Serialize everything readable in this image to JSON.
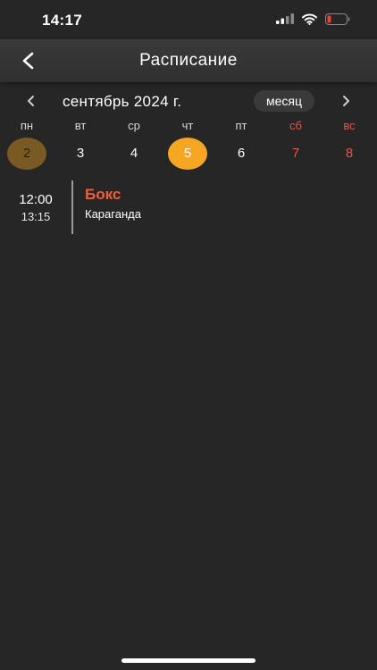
{
  "status_bar": {
    "time": "14:17",
    "icons": [
      "signal-icon",
      "wifi-icon",
      "battery-icon"
    ]
  },
  "header": {
    "title": "Расписание",
    "back_icon": "chevron-left-icon"
  },
  "calendar": {
    "month_label": "сентябрь 2024 г.",
    "view_toggle_label": "месяц",
    "prev_icon": "chevron-left-icon",
    "next_icon": "chevron-right-icon",
    "weekdays": [
      {
        "label": "пн",
        "weekend": false
      },
      {
        "label": "вт",
        "weekend": false
      },
      {
        "label": "ср",
        "weekend": false
      },
      {
        "label": "чт",
        "weekend": false
      },
      {
        "label": "пт",
        "weekend": false
      },
      {
        "label": "сб",
        "weekend": true
      },
      {
        "label": "вс",
        "weekend": true
      }
    ],
    "days": [
      {
        "label": "2",
        "state": "current"
      },
      {
        "label": "3",
        "state": "normal"
      },
      {
        "label": "4",
        "state": "normal"
      },
      {
        "label": "5",
        "state": "selected"
      },
      {
        "label": "6",
        "state": "normal"
      },
      {
        "label": "7",
        "state": "weekend"
      },
      {
        "label": "8",
        "state": "weekend"
      }
    ]
  },
  "events": [
    {
      "start": "12:00",
      "end": "13:15",
      "title": "Бокс",
      "location": "Караганда"
    }
  ],
  "colors": {
    "background": "#262626",
    "accent_selected": "#f5a623",
    "current_day": "#7a5a24",
    "weekend": "#e0574a",
    "event_title": "#e8603f"
  }
}
